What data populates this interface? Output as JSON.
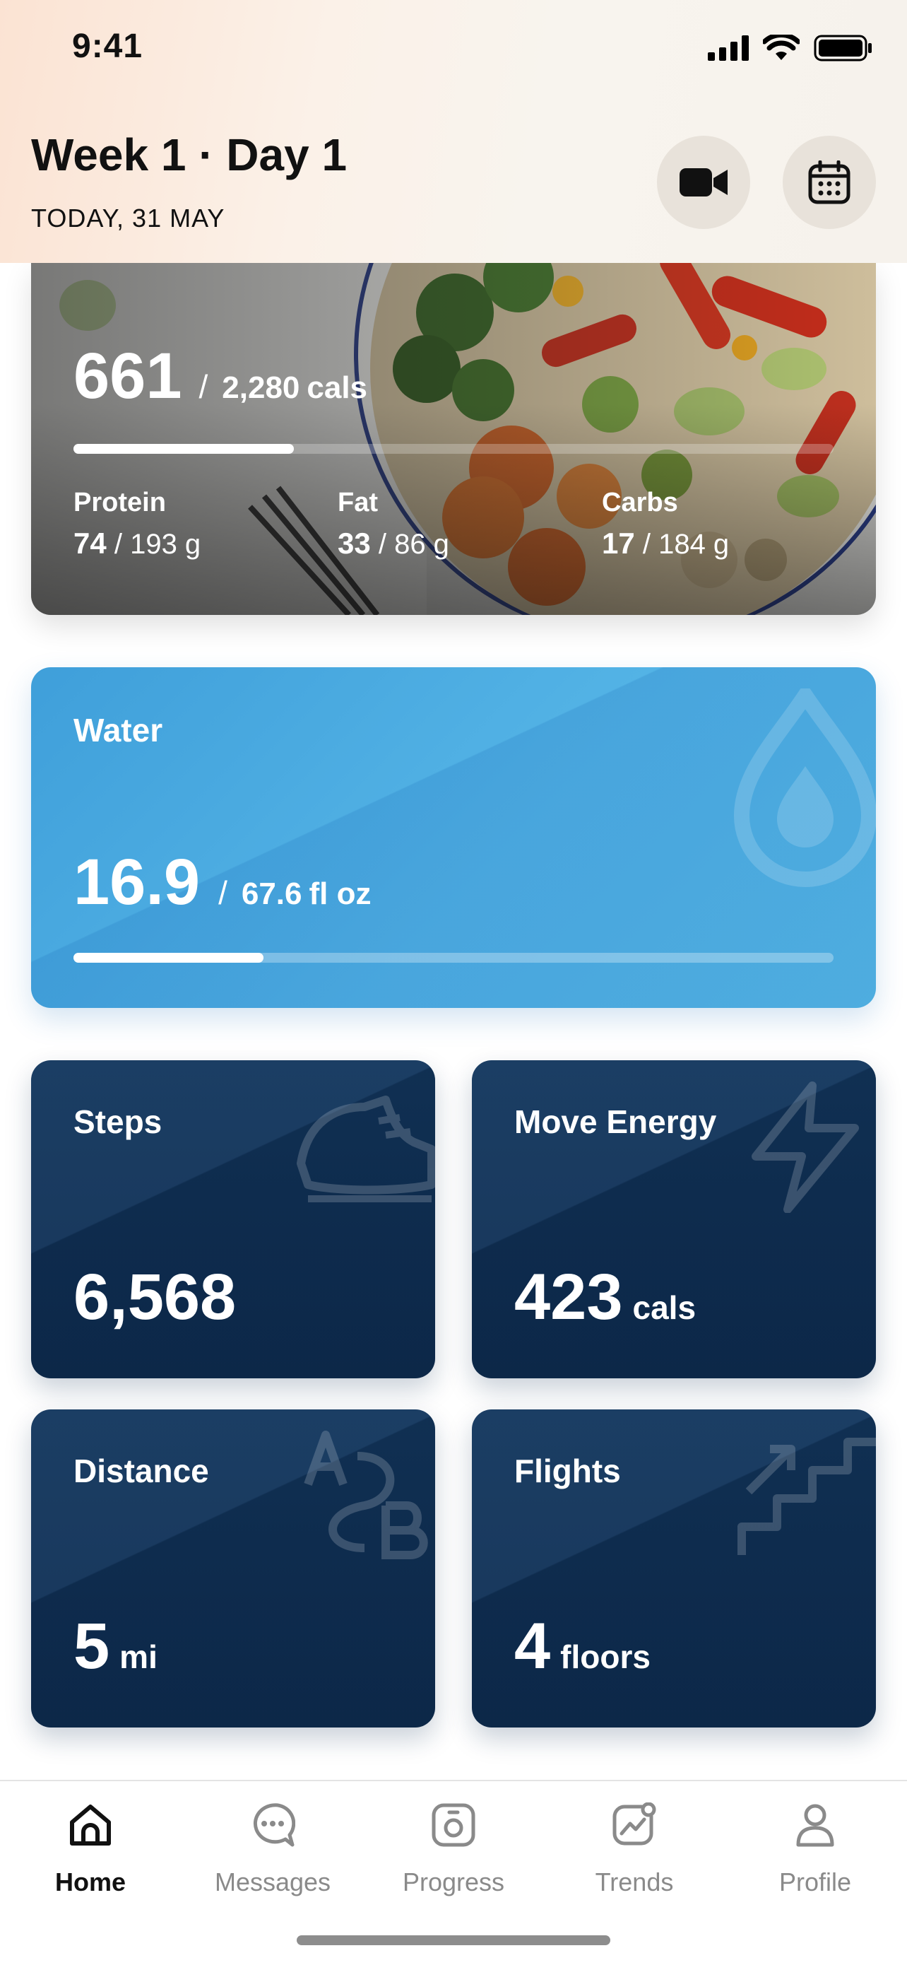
{
  "status_bar": {
    "time": "9:41"
  },
  "header": {
    "title": "Week 1 · Day 1",
    "date": "TODAY, 31 MAY",
    "buttons": {
      "video": "video-camera-icon",
      "calendar": "calendar-icon"
    }
  },
  "calories": {
    "consumed": "661",
    "separator": "/",
    "target": "2,280",
    "unit": "cals",
    "progress": 0.29,
    "macros": [
      {
        "label": "Protein",
        "value": "74",
        "target": "/ 193 g"
      },
      {
        "label": "Fat",
        "value": "33",
        "target": "/ 86 g"
      },
      {
        "label": "Carbs",
        "value": "17",
        "target": "/ 184 g"
      }
    ]
  },
  "water": {
    "title": "Water",
    "value": "16.9",
    "separator": "/",
    "target": "67.6",
    "unit": "fl oz",
    "progress": 0.25,
    "icon": "water-drop-icon"
  },
  "stats": [
    {
      "title": "Steps",
      "value": "6,568",
      "unit": "",
      "icon": "sneaker-icon"
    },
    {
      "title": "Move Energy",
      "value": "423",
      "unit": "cals",
      "icon": "lightning-icon"
    },
    {
      "title": "Distance",
      "value": "5",
      "unit": "mi",
      "icon": "a-to-b-route-icon"
    },
    {
      "title": "Flights",
      "value": "4",
      "unit": "floors",
      "icon": "stairs-icon"
    }
  ],
  "tabs": [
    {
      "label": "Home",
      "icon": "home-icon",
      "active": true
    },
    {
      "label": "Messages",
      "icon": "chat-bubble-icon",
      "active": false
    },
    {
      "label": "Progress",
      "icon": "progress-camera-icon",
      "active": false
    },
    {
      "label": "Trends",
      "icon": "trends-chart-icon",
      "active": false
    },
    {
      "label": "Profile",
      "icon": "person-icon",
      "active": false
    }
  ],
  "colors": {
    "water_card": "#4aaae0",
    "stat_card": "#0f3158",
    "accent_text": "#ffffff"
  }
}
